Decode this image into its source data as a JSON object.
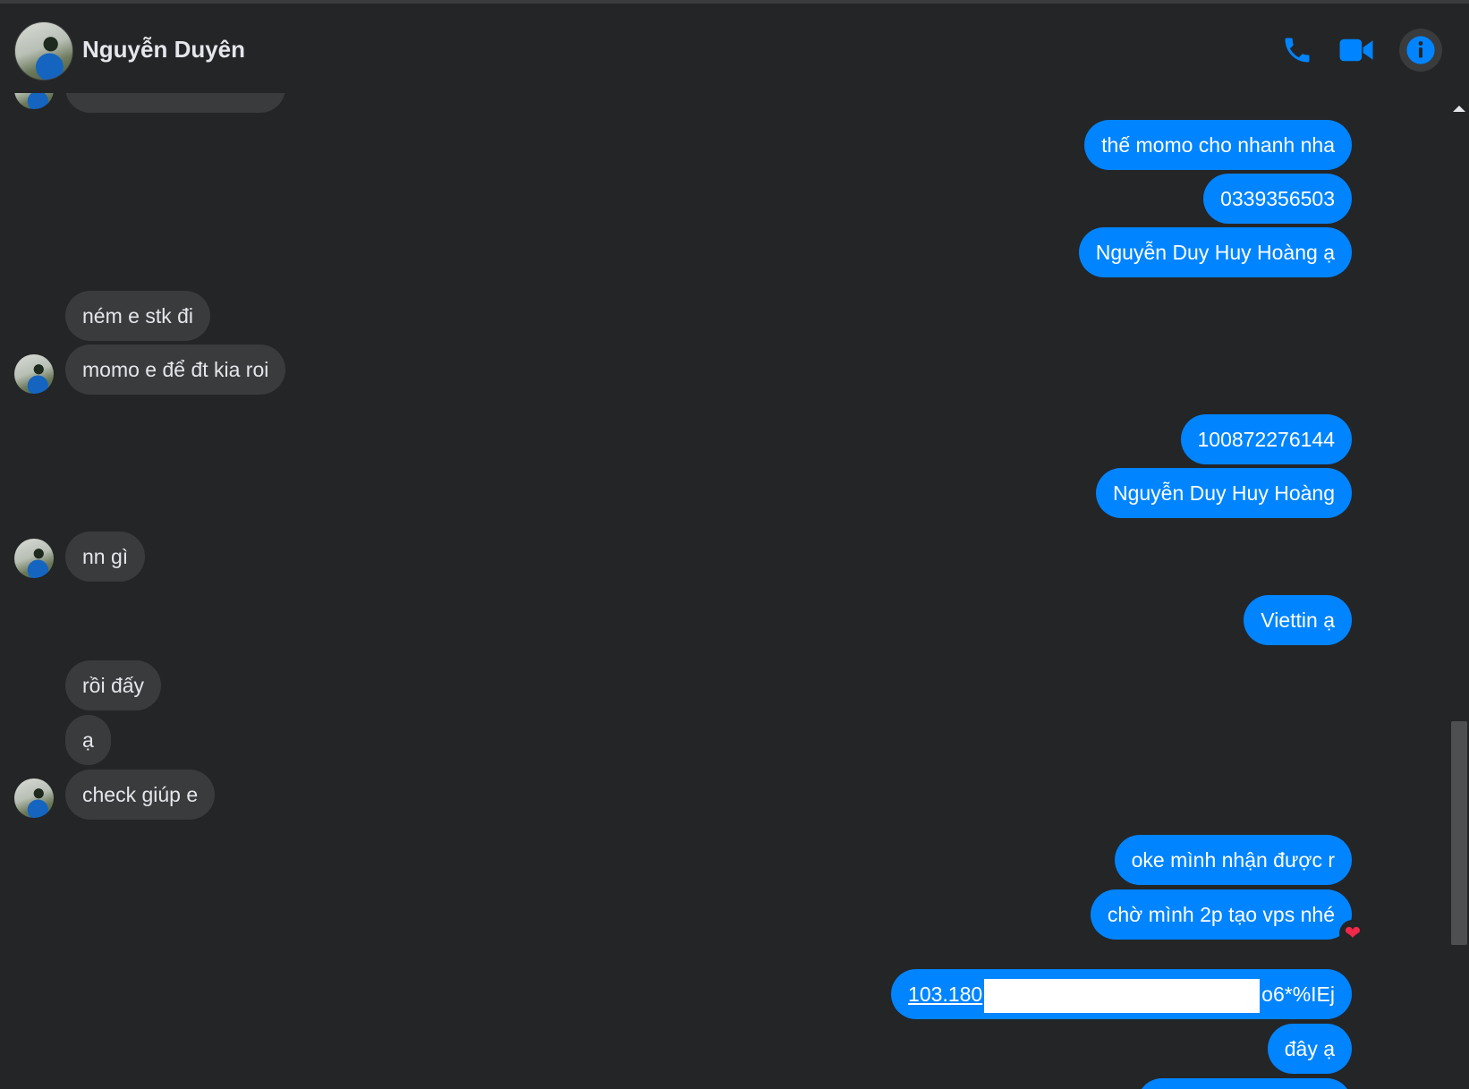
{
  "header": {
    "contact_name": "Nguyễn Duyên",
    "icons": [
      "phone-icon",
      "video-camera-icon",
      "info-icon"
    ]
  },
  "colors": {
    "background": "#242526",
    "incoming_bubble": "#3a3b3c",
    "outgoing_bubble": "#0084ff",
    "accent": "#0084ff",
    "reaction_heart": "#f02849"
  },
  "messages": [
    {
      "side": "out",
      "text": "thế momo cho nhanh nha"
    },
    {
      "side": "out",
      "text": "0339356503"
    },
    {
      "side": "out",
      "text": "Nguyễn Duy Huy Hoàng ạ"
    },
    {
      "side": "in",
      "text": "ném e stk đi"
    },
    {
      "side": "in",
      "text": "momo e để đt kia roi"
    },
    {
      "side": "out",
      "text": "100872276144"
    },
    {
      "side": "out",
      "text": "Nguyễn Duy Huy Hoàng"
    },
    {
      "side": "in",
      "text": "nn gì"
    },
    {
      "side": "out",
      "text": "Viettin ạ"
    },
    {
      "side": "in",
      "text": "rồi đấy"
    },
    {
      "side": "in",
      "text": "ạ"
    },
    {
      "side": "in",
      "text": "check giúp e"
    },
    {
      "side": "out",
      "text": "oke mình nhận được r"
    },
    {
      "side": "out",
      "text": "chờ mình 2p tạo vps nhé",
      "reaction": "❤"
    },
    {
      "side": "out",
      "link_text": "103.180",
      "suffix": "o6*%IEj"
    },
    {
      "side": "out",
      "text": "đây ạ"
    }
  ]
}
